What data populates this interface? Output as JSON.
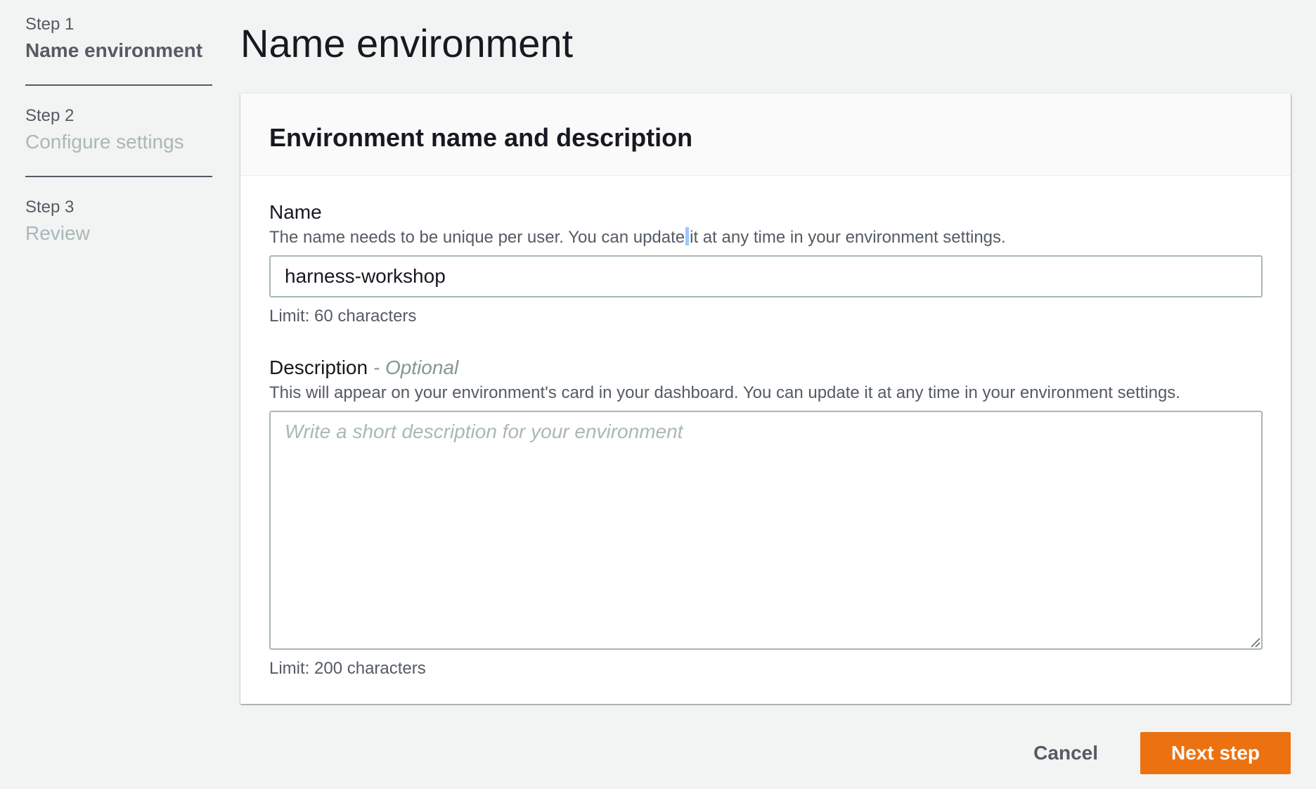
{
  "steps": [
    {
      "number": "Step 1",
      "title": "Name environment",
      "active": true
    },
    {
      "number": "Step 2",
      "title": "Configure settings",
      "active": false
    },
    {
      "number": "Step 3",
      "title": "Review",
      "active": false
    }
  ],
  "page": {
    "title": "Name environment"
  },
  "card": {
    "title": "Environment name and description",
    "name_field": {
      "label": "Name",
      "description_before_cursor": "The name needs to be unique per user. You can update",
      "description_after_cursor": "it at any time in your environment settings.",
      "value": "harness-workshop",
      "hint": "Limit: 60 characters"
    },
    "description_field": {
      "label": "Description",
      "optional": "- Optional",
      "description": "This will appear on your environment's card in your dashboard. You can update it at any time in your environment settings.",
      "placeholder": "Write a short description for your environment",
      "hint": "Limit: 200 characters"
    }
  },
  "actions": {
    "cancel_label": "Cancel",
    "next_label": "Next step"
  },
  "colors": {
    "primary_button": "#ec7211",
    "page_background": "#f2f3f3",
    "muted_text": "#aab7b8"
  }
}
